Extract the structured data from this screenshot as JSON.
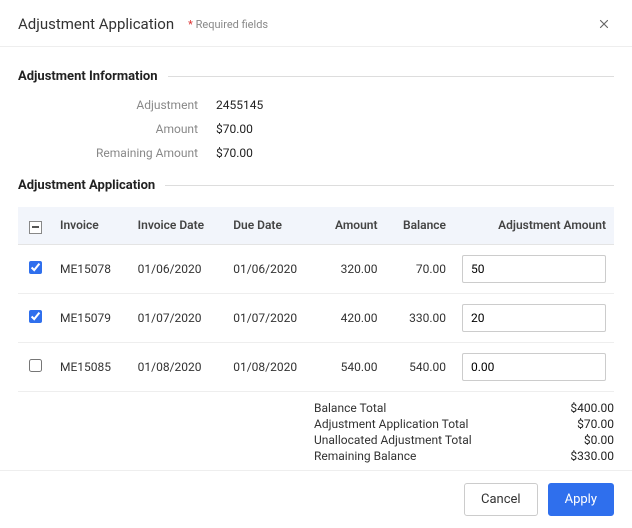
{
  "header": {
    "title": "Adjustment Application",
    "required_fields_label": "Required fields"
  },
  "sections": {
    "info_title": "Adjustment Information",
    "app_title": "Adjustment Application"
  },
  "info": {
    "adjustment_label": "Adjustment",
    "adjustment_value": "2455145",
    "amount_label": "Amount",
    "amount_value": "$70.00",
    "remaining_label": "Remaining Amount",
    "remaining_value": "$70.00"
  },
  "table": {
    "headers": {
      "invoice": "Invoice",
      "invoice_date": "Invoice Date",
      "due_date": "Due Date",
      "amount": "Amount",
      "balance": "Balance",
      "adjustment_amount": "Adjustment Amount"
    },
    "rows": [
      {
        "checked": true,
        "invoice": "ME15078",
        "invoice_date": "01/06/2020",
        "due_date": "01/06/2020",
        "amount": "320.00",
        "balance": "70.00",
        "adjustment_amount": "50"
      },
      {
        "checked": true,
        "invoice": "ME15079",
        "invoice_date": "01/07/2020",
        "due_date": "01/07/2020",
        "amount": "420.00",
        "balance": "330.00",
        "adjustment_amount": "20"
      },
      {
        "checked": false,
        "invoice": "ME15085",
        "invoice_date": "01/08/2020",
        "due_date": "01/08/2020",
        "amount": "540.00",
        "balance": "540.00",
        "adjustment_amount": "0.00"
      }
    ]
  },
  "totals": {
    "balance_total_label": "Balance Total",
    "balance_total_value": "$400.00",
    "app_total_label": "Adjustment Application Total",
    "app_total_value": "$70.00",
    "unallocated_label": "Unallocated Adjustment Total",
    "unallocated_value": "$0.00",
    "remaining_balance_label": "Remaining Balance",
    "remaining_balance_value": "$330.00"
  },
  "footer": {
    "cancel_label": "Cancel",
    "apply_label": "Apply"
  }
}
